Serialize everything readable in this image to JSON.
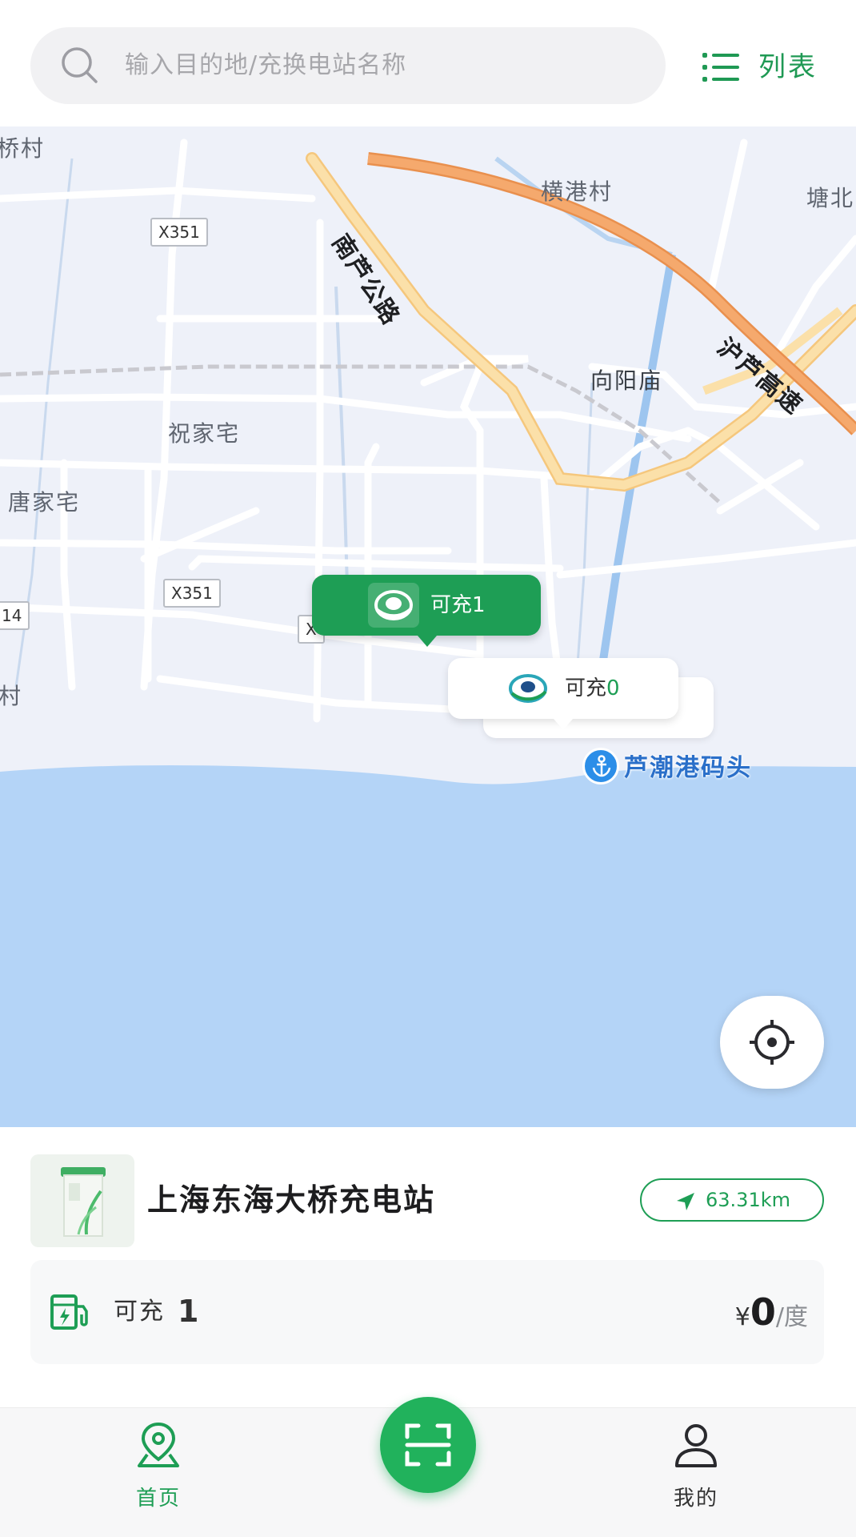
{
  "search": {
    "placeholder": "输入目的地/充换电站名称",
    "list_label": "列表"
  },
  "map": {
    "place_labels": [
      "桥村",
      "横港村",
      "塘北",
      "祝家宅",
      "向阳庙",
      "唐家宅",
      "村"
    ],
    "road_names": [
      "南芦公路",
      "沪芦高速"
    ],
    "road_shields": [
      "X351",
      "X351",
      "14",
      "X"
    ],
    "markers": [
      {
        "label": "可充",
        "count": "1",
        "state": "active"
      },
      {
        "label": "可充",
        "count": "0",
        "state": "inactive"
      }
    ],
    "poi": {
      "label": "芦潮港码头",
      "icon": "anchor-icon"
    },
    "colors": {
      "land": "#eef1f9",
      "water": "#b4d4f7",
      "highway": "#f2a36a",
      "primary_road": "#fbd89a",
      "accent": "#1e9e55"
    }
  },
  "station": {
    "name": "上海东海大桥充电站",
    "distance": "63.31km",
    "available_label": "可充",
    "available_count": "1",
    "price_symbol": "¥",
    "price_value": "0",
    "price_unit": "/度"
  },
  "nav": {
    "home_label": "首页",
    "mine_label": "我的",
    "scan_icon": "scan-icon"
  }
}
